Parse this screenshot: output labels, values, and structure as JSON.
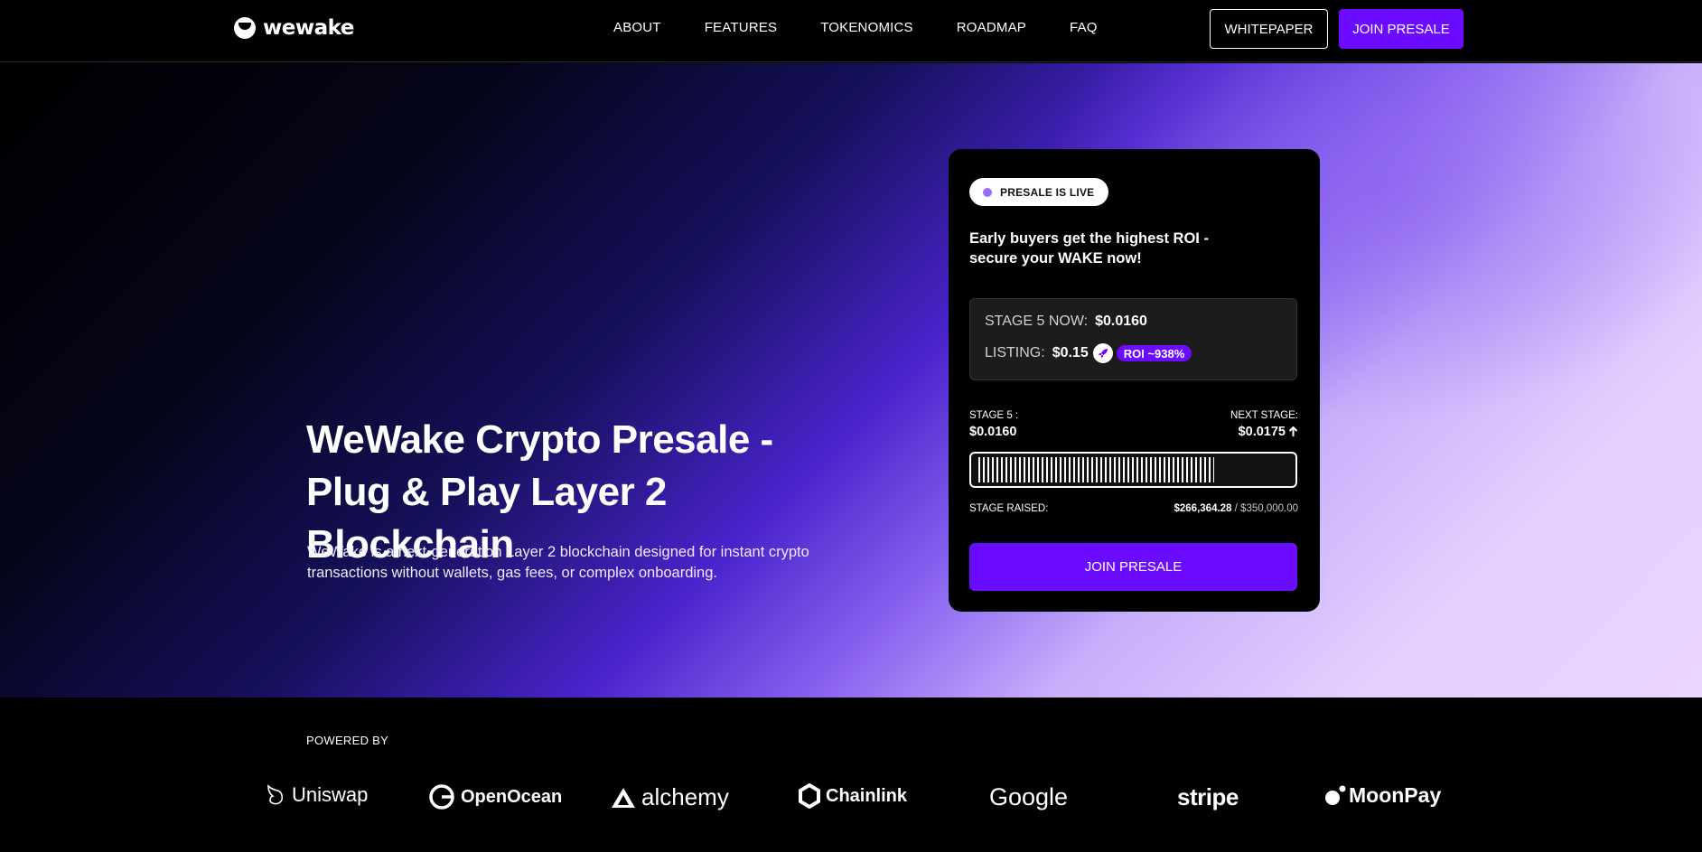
{
  "nav": {
    "logo_text": "wewake",
    "links": [
      "ABOUT",
      "FEATURES",
      "TOKENOMICS",
      "ROADMAP",
      "FAQ"
    ],
    "whitepaper_label": "WHITEPAPER",
    "join_label": "JOIN PRESALE"
  },
  "hero": {
    "title_line1": "WeWake Crypto Presale -",
    "title_line2": "Plug & Play Layer 2 Blockchain",
    "subtitle": "WeWake is a next-generation Layer 2 blockchain designed for instant crypto transactions without wallets, gas fees, or complex onboarding."
  },
  "card": {
    "live_label": "PRESALE IS LIVE",
    "headline": "Early buyers get the highest ROI - secure your WAKE now!",
    "stage_now_label": "STAGE 5 NOW:",
    "stage_now_value": "$0.0160",
    "listing_label": "LISTING:",
    "listing_value": "$0.15",
    "roi_label": "ROI ~938%",
    "stage_label": "STAGE 5 :",
    "stage_value": "$0.0160",
    "next_stage_label": "NEXT STAGE:",
    "next_stage_value": "$0.0175",
    "raised_label": "STAGE RAISED:",
    "raised_value": "$266,364.28",
    "raised_separator": " / ",
    "raised_target": "$350,000.00",
    "progress_fraction": 0.761,
    "join_label": "JOIN PRESALE"
  },
  "powered": {
    "label": "POWERED BY",
    "partners": [
      "Uniswap",
      "OpenOcean",
      "alchemy",
      "Chainlink",
      "Google",
      "stripe",
      "MoonPay"
    ]
  },
  "colors": {
    "accent": "#6b0bff",
    "live_dot": "#9b6cf5"
  }
}
